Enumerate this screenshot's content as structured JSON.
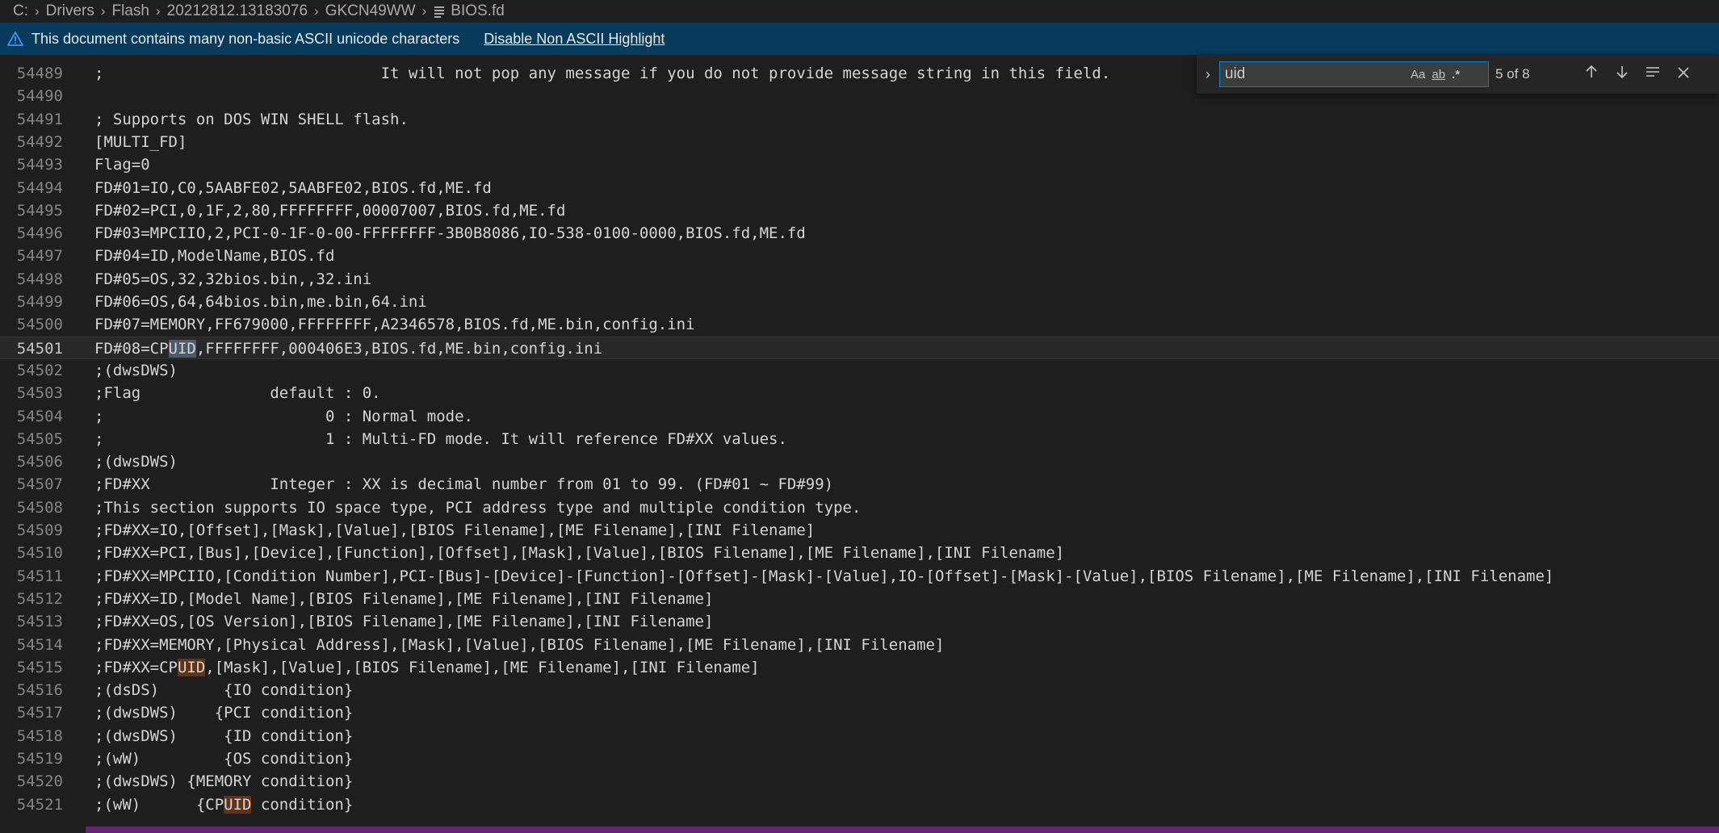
{
  "breadcrumb": {
    "items": [
      "C:",
      "Drivers",
      "Flash",
      "20212812.13183076",
      "GKCN49WW",
      "BIOS.fd"
    ],
    "file_icon": "file-text-icon"
  },
  "banner": {
    "icon": "warning-icon",
    "message": "This document contains many non-basic ASCII unicode characters",
    "action": "Disable Non ASCII Highlight"
  },
  "find": {
    "query": "uid",
    "match_case_label": "Aa",
    "whole_word_label": "ab",
    "regex_label": ".*",
    "count": "5 of 8",
    "icons": {
      "toggle": "chevron-right-icon",
      "prev": "arrow-up-icon",
      "next": "arrow-down-icon",
      "in_selection": "list-selection-icon",
      "close": "close-icon"
    }
  },
  "editor": {
    "current_line": "54501",
    "lines": [
      {
        "n": "54489",
        "segs": [
          ";                              It will not pop any message if you do not provide message string in this field."
        ]
      },
      {
        "n": "54490",
        "segs": [
          ""
        ]
      },
      {
        "n": "54491",
        "segs": [
          "; Supports on DOS WIN SHELL flash."
        ]
      },
      {
        "n": "54492",
        "segs": [
          "[MULTI_FD]"
        ]
      },
      {
        "n": "54493",
        "segs": [
          "Flag=0"
        ]
      },
      {
        "n": "54494",
        "segs": [
          "FD#01=IO,C0,5AABFE02,5AABFE02,BIOS.fd,ME.fd"
        ]
      },
      {
        "n": "54495",
        "segs": [
          "FD#02=PCI,0,1F,2,80,FFFFFFFF,00007007,BIOS.fd,ME.fd"
        ]
      },
      {
        "n": "54496",
        "segs": [
          "FD#03=MPCIIO,2,PCI-0-1F-0-00-FFFFFFFF-3B0B8086,IO-538-0100-0000,BIOS.fd,ME.fd"
        ]
      },
      {
        "n": "54497",
        "segs": [
          "FD#04=ID,ModelName,BIOS.fd"
        ]
      },
      {
        "n": "54498",
        "segs": [
          "FD#05=OS,32,32bios.bin,,32.ini"
        ]
      },
      {
        "n": "54499",
        "segs": [
          "FD#06=OS,64,64bios.bin,me.bin,64.ini"
        ]
      },
      {
        "n": "54500",
        "segs": [
          "FD#07=MEMORY,FF679000,FFFFFFFF,A2346578,BIOS.fd,ME.bin,config.ini"
        ]
      },
      {
        "n": "54501",
        "segs": [
          "FD#08=CP",
          "UID",
          ",FFFFFFFF,000406E3,BIOS.fd,ME.bin,config.ini"
        ],
        "hl": "current"
      },
      {
        "n": "54502",
        "segs": [
          ";(dwsDWS)"
        ]
      },
      {
        "n": "54503",
        "segs": [
          ";Flag              default : 0."
        ]
      },
      {
        "n": "54504",
        "segs": [
          ";                        0 : Normal mode."
        ]
      },
      {
        "n": "54505",
        "segs": [
          ";                        1 : Multi-FD mode. It will reference FD#XX values."
        ]
      },
      {
        "n": "54506",
        "segs": [
          ";(dwsDWS)"
        ]
      },
      {
        "n": "54507",
        "segs": [
          ";FD#XX             Integer : XX is decimal number from 01 to 99. (FD#01 ~ FD#99)"
        ]
      },
      {
        "n": "54508",
        "segs": [
          ";This section supports IO space type, PCI address type and multiple condition type."
        ]
      },
      {
        "n": "54509",
        "segs": [
          ";FD#XX=IO,[Offset],[Mask],[Value],[BIOS Filename],[ME Filename],[INI Filename]"
        ]
      },
      {
        "n": "54510",
        "segs": [
          ";FD#XX=PCI,[Bus],[Device],[Function],[Offset],[Mask],[Value],[BIOS Filename],[ME Filename],[INI Filename]"
        ]
      },
      {
        "n": "54511",
        "segs": [
          ";FD#XX=MPCIIO,[Condition Number],PCI-[Bus]-[Device]-[Function]-[Offset]-[Mask]-[Value],IO-[Offset]-[Mask]-[Value],[BIOS Filename],[ME Filename],[INI Filename]"
        ]
      },
      {
        "n": "54512",
        "segs": [
          ";FD#XX=ID,[Model Name],[BIOS Filename],[ME Filename],[INI Filename]"
        ]
      },
      {
        "n": "54513",
        "segs": [
          ";FD#XX=OS,[OS Version],[BIOS Filename],[ME Filename],[INI Filename]"
        ]
      },
      {
        "n": "54514",
        "segs": [
          ";FD#XX=MEMORY,[Physical Address],[Mask],[Value],[BIOS Filename],[ME Filename],[INI Filename]"
        ]
      },
      {
        "n": "54515",
        "segs": [
          ";FD#XX=CP",
          "UID",
          ",[Mask],[Value],[BIOS Filename],[ME Filename],[INI Filename]"
        ],
        "hl": "match"
      },
      {
        "n": "54516",
        "segs": [
          ";(dsDS)       {IO condition}"
        ]
      },
      {
        "n": "54517",
        "segs": [
          ";(dwsDWS)    {PCI condition}"
        ]
      },
      {
        "n": "54518",
        "segs": [
          ";(dwsDWS)     {ID condition}"
        ]
      },
      {
        "n": "54519",
        "segs": [
          ";(wW)         {OS condition}"
        ]
      },
      {
        "n": "54520",
        "segs": [
          ";(dwsDWS) {MEMORY condition}"
        ]
      },
      {
        "n": "54521",
        "segs": [
          ";(wW)      {CP",
          "UID",
          " condition}"
        ],
        "hl": "match"
      }
    ]
  },
  "colors": {
    "editor_bg": "#1e1e1e",
    "banner_bg": "#063b5c",
    "match_bg": "#623315",
    "current_match_bg": "#4d5a6a",
    "panel_accent": "#68217a"
  }
}
